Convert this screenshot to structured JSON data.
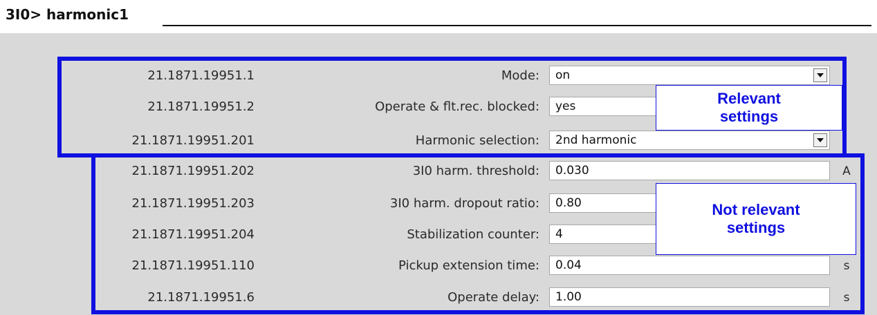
{
  "header": {
    "title": "3I0> harmonic1"
  },
  "rows": [
    {
      "id": "21.1871.19951.1",
      "label": "Mode:",
      "value": "on",
      "kind": "select",
      "unit": ""
    },
    {
      "id": "21.1871.19951.2",
      "label": "Operate & flt.rec. blocked:",
      "value": "yes",
      "kind": "select",
      "unit": ""
    },
    {
      "id": "21.1871.19951.201",
      "label": "Harmonic selection:",
      "value": "2nd harmonic",
      "kind": "select",
      "unit": ""
    },
    {
      "id": "21.1871.19951.202",
      "label": "3I0 harm. threshold:",
      "value": "0.030",
      "kind": "text",
      "unit": "A"
    },
    {
      "id": "21.1871.19951.203",
      "label": "3I0 harm. dropout ratio:",
      "value": "0.80",
      "kind": "text",
      "unit": ""
    },
    {
      "id": "21.1871.19951.204",
      "label": "Stabilization counter:",
      "value": "4",
      "kind": "text",
      "unit": ""
    },
    {
      "id": "21.1871.19951.110",
      "label": "Pickup extension time:",
      "value": "0.04",
      "kind": "text",
      "unit": "s"
    },
    {
      "id": "21.1871.19951.6",
      "label": "Operate delay:",
      "value": "1.00",
      "kind": "text",
      "unit": "s"
    }
  ],
  "callouts": {
    "relevant": "Relevant settings",
    "not_relevant": "Not relevant settings"
  },
  "colors": {
    "highlight": "#1010e0",
    "panel": "#d9d9d9"
  }
}
